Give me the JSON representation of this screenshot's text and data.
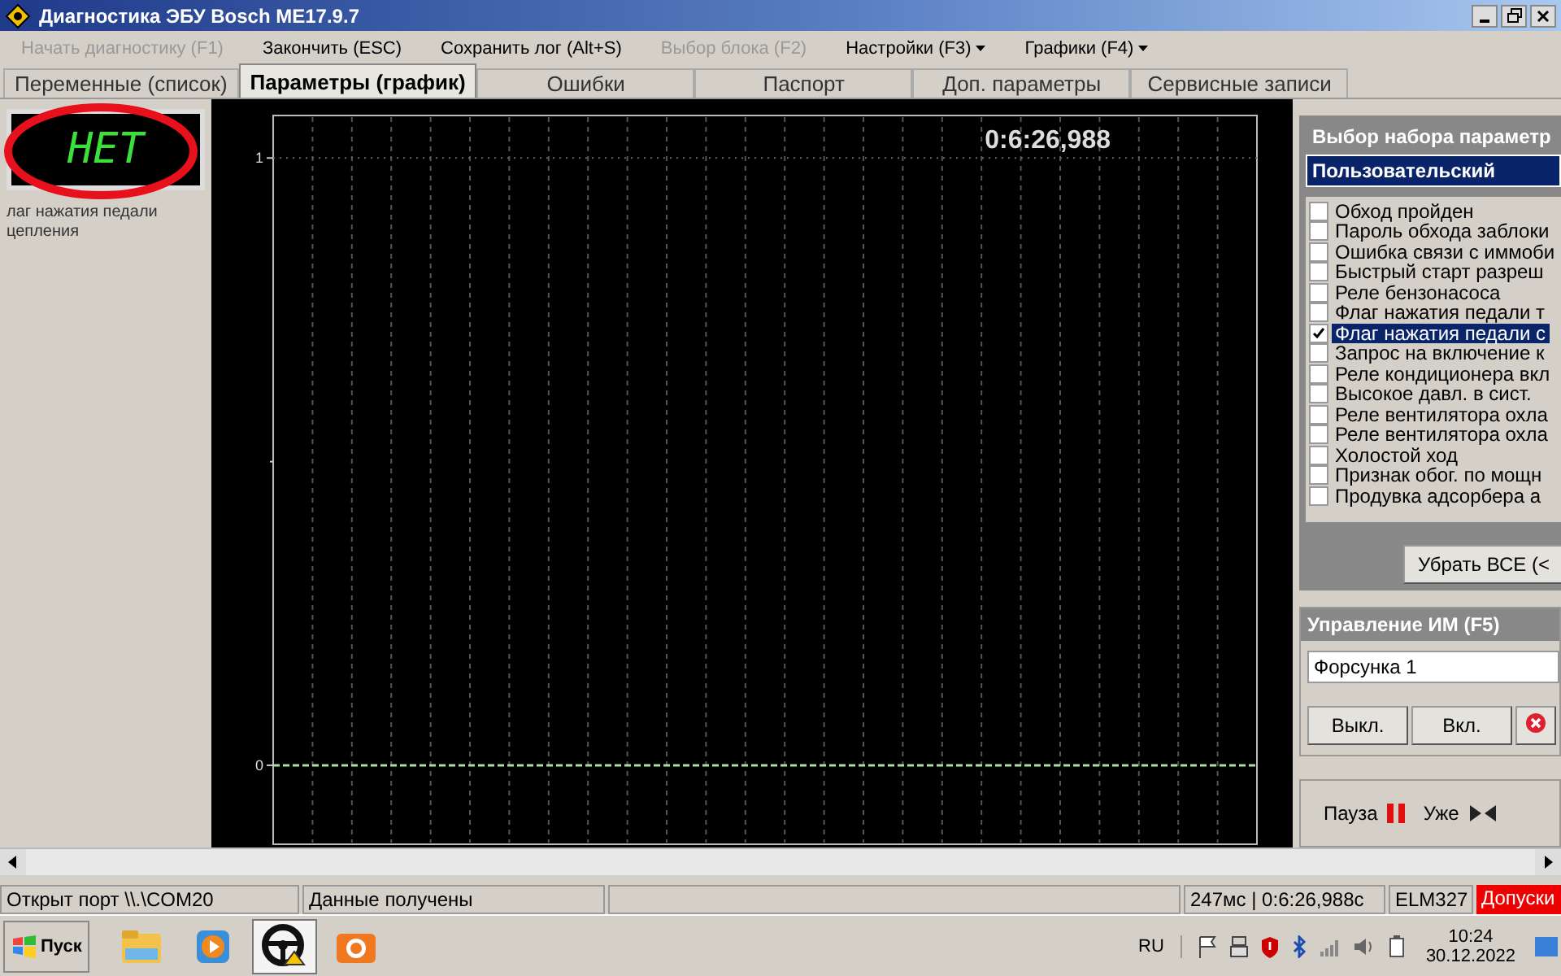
{
  "window": {
    "title": "Диагностика ЭБУ Bosch ME17.9.7"
  },
  "menu": [
    {
      "label": "Начать диагностику (F1)",
      "disabled": true,
      "dropdown": false
    },
    {
      "label": "Закончить (ESC)",
      "disabled": false,
      "dropdown": false
    },
    {
      "label": "Сохранить лог (Alt+S)",
      "disabled": false,
      "dropdown": false
    },
    {
      "label": "Выбор блока (F2)",
      "disabled": true,
      "dropdown": false
    },
    {
      "label": "Настройки (F3)",
      "disabled": false,
      "dropdown": true
    },
    {
      "label": "Графики (F4)",
      "disabled": false,
      "dropdown": true
    }
  ],
  "tabs": [
    {
      "label": "Переменные (список)",
      "selected": false
    },
    {
      "label": "Параметры (график)",
      "selected": true
    },
    {
      "label": "Ошибки",
      "selected": false
    },
    {
      "label": "Паспорт",
      "selected": false
    },
    {
      "label": "Доп. параметры",
      "selected": false
    },
    {
      "label": "Сервисные записи",
      "selected": false
    }
  ],
  "indicator": {
    "value": "НЕТ",
    "label_lines": [
      "лаг нажатия педали",
      "цепления"
    ]
  },
  "chart": {
    "timer": "0:6:26,988",
    "chart_data": {
      "type": "line",
      "ylim": [
        -0.13,
        1.07
      ],
      "yticks": [
        0,
        1
      ],
      "grid": true,
      "ref_lines": [
        {
          "axis": "y",
          "value": 1
        }
      ],
      "series": [
        {
          "color": "#a8e0a8",
          "line_style": "dashed",
          "values": [
            0,
            0,
            0,
            0,
            0,
            0,
            0,
            0,
            0,
            0,
            0,
            0,
            0,
            0,
            0,
            0,
            0,
            0,
            0,
            0
          ]
        }
      ]
    }
  },
  "param_set": {
    "title": "Выбор набора параметр",
    "value": "Пользовательский",
    "items": [
      {
        "label": "Обход пройден",
        "checked": false,
        "selected": false
      },
      {
        "label": "Пароль обхода заблоки",
        "checked": false,
        "selected": false
      },
      {
        "label": "Ошибка связи с иммоби",
        "checked": false,
        "selected": false
      },
      {
        "label": "Быстрый старт разреш",
        "checked": false,
        "selected": false
      },
      {
        "label": "Реле бензонасоса",
        "checked": false,
        "selected": false
      },
      {
        "label": "Флаг нажатия педали т",
        "checked": false,
        "selected": false
      },
      {
        "label": "Флаг нажатия педали с",
        "checked": true,
        "selected": true
      },
      {
        "label": "Запрос на включение к",
        "checked": false,
        "selected": false
      },
      {
        "label": "Реле кондиционера вкл",
        "checked": false,
        "selected": false
      },
      {
        "label": "Высокое давл. в сист.",
        "checked": false,
        "selected": false
      },
      {
        "label": "Реле вентилятора охла",
        "checked": false,
        "selected": false
      },
      {
        "label": "Реле вентилятора охла",
        "checked": false,
        "selected": false
      },
      {
        "label": "Холостой ход",
        "checked": false,
        "selected": false
      },
      {
        "label": "Признак обог. по мощн",
        "checked": false,
        "selected": false
      },
      {
        "label": "Продувка адсорбера а",
        "checked": false,
        "selected": false
      }
    ],
    "button": "Убрать ВСЕ (<"
  },
  "actuators": {
    "title": "Управление ИМ (F5)",
    "value": "Форсунка 1",
    "buttons": [
      "Выкл.",
      "Вкл."
    ]
  },
  "playback": {
    "pause": "Пауза",
    "narrow": "Уже"
  },
  "status_bar": [
    "Открыт порт \\\\.\\COM20",
    "Данные получены",
    "247мс | 0:6:26,988с",
    "ELM327"
  ],
  "status_alert": "Допуски",
  "taskbar": {
    "start": "Пуск",
    "language": "RU",
    "time": "10:24",
    "date": "30.12.2022"
  }
}
